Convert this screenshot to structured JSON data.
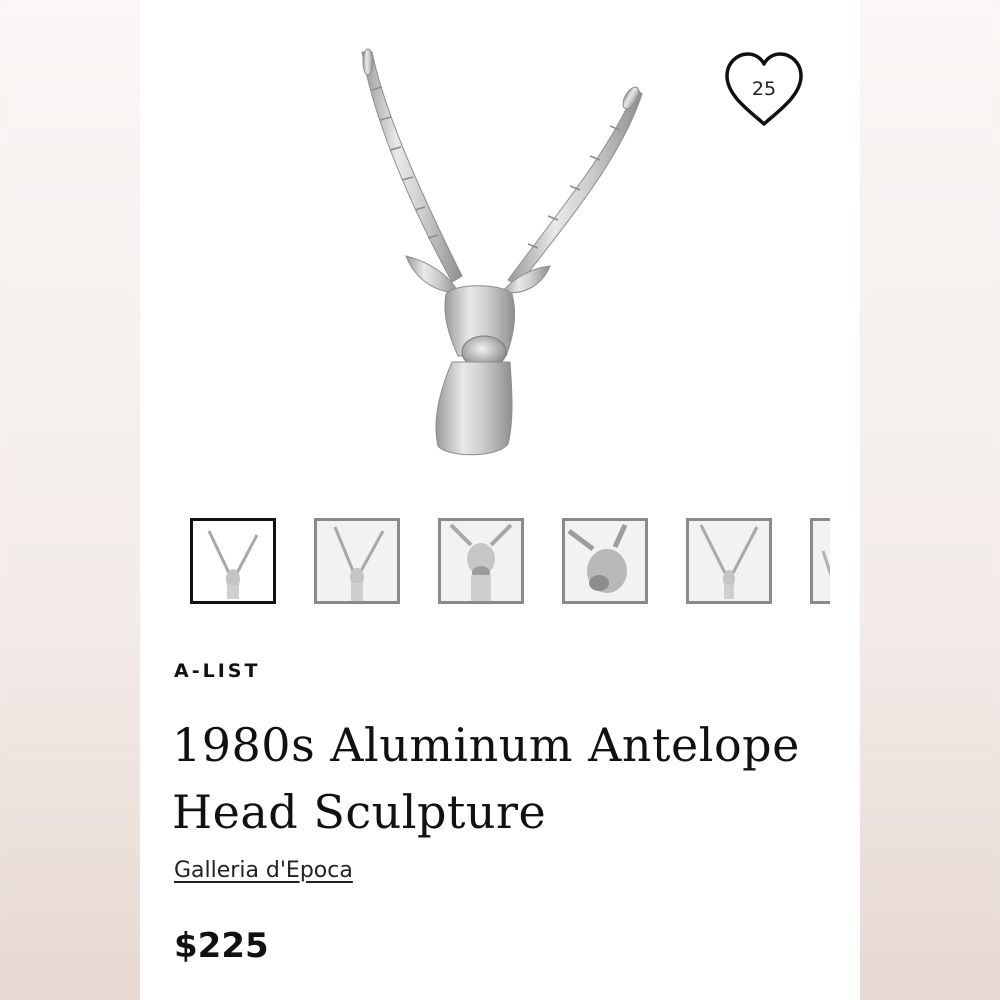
{
  "favorite": {
    "count": "25",
    "icon": "heart-icon"
  },
  "gallery": {
    "main_image_alt": "Antelope head sculpture",
    "thumbnails": [
      {
        "icon": "antelope-full-thumbnail",
        "selected": true
      },
      {
        "icon": "antelope-full-thumbnail",
        "selected": false
      },
      {
        "icon": "antelope-head-closeup-thumbnail",
        "selected": false
      },
      {
        "icon": "antelope-angle-thumbnail",
        "selected": false
      },
      {
        "icon": "antelope-full-thumbnail",
        "selected": false
      },
      {
        "icon": "antelope-partial-thumbnail",
        "selected": false
      }
    ]
  },
  "product": {
    "tag": "A-LIST",
    "title_line1": "1980s Aluminum Antelope",
    "title_line2": "Head Sculpture",
    "seller": "Galleria d'Epoca",
    "price": "$225"
  },
  "colors": {
    "text": "#111111",
    "thumb_border": "#8a8a8a",
    "thumb_border_active": "#111111",
    "metal": "#c8c8c8"
  }
}
